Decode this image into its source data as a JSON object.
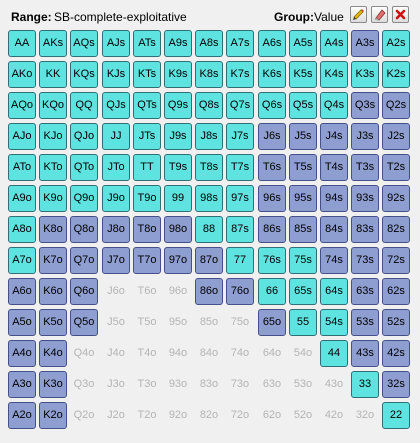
{
  "header": {
    "range_label": "Range:",
    "range_name": "SB-complete-exploitative",
    "group_label": "Group:",
    "group_name": "Value",
    "buttons": [
      "pencil-icon",
      "eraser-icon",
      "close-icon"
    ]
  },
  "colors": {
    "value": "#5fe3e0",
    "other": "#8f9ed0",
    "empty_text": "#b4b4b4"
  },
  "state_legend": {
    "c": "value group",
    "b": "other group",
    "e": "not in range"
  },
  "grid": [
    [
      [
        "AA",
        "c"
      ],
      [
        "AKs",
        "c"
      ],
      [
        "AQs",
        "c"
      ],
      [
        "AJs",
        "c"
      ],
      [
        "ATs",
        "c"
      ],
      [
        "A9s",
        "c"
      ],
      [
        "A8s",
        "c"
      ],
      [
        "A7s",
        "c"
      ],
      [
        "A6s",
        "c"
      ],
      [
        "A5s",
        "c"
      ],
      [
        "A4s",
        "c"
      ],
      [
        "A3s",
        "b"
      ],
      [
        "A2s",
        "c"
      ]
    ],
    [
      [
        "AKo",
        "c"
      ],
      [
        "KK",
        "c"
      ],
      [
        "KQs",
        "c"
      ],
      [
        "KJs",
        "c"
      ],
      [
        "KTs",
        "c"
      ],
      [
        "K9s",
        "c"
      ],
      [
        "K8s",
        "c"
      ],
      [
        "K7s",
        "c"
      ],
      [
        "K6s",
        "c"
      ],
      [
        "K5s",
        "c"
      ],
      [
        "K4s",
        "c"
      ],
      [
        "K3s",
        "c"
      ],
      [
        "K2s",
        "c"
      ]
    ],
    [
      [
        "AQo",
        "c"
      ],
      [
        "KQo",
        "c"
      ],
      [
        "QQ",
        "c"
      ],
      [
        "QJs",
        "c"
      ],
      [
        "QTs",
        "c"
      ],
      [
        "Q9s",
        "c"
      ],
      [
        "Q8s",
        "c"
      ],
      [
        "Q7s",
        "c"
      ],
      [
        "Q6s",
        "c"
      ],
      [
        "Q5s",
        "c"
      ],
      [
        "Q4s",
        "c"
      ],
      [
        "Q3s",
        "b"
      ],
      [
        "Q2s",
        "b"
      ]
    ],
    [
      [
        "AJo",
        "c"
      ],
      [
        "KJo",
        "c"
      ],
      [
        "QJo",
        "c"
      ],
      [
        "JJ",
        "c"
      ],
      [
        "JTs",
        "c"
      ],
      [
        "J9s",
        "c"
      ],
      [
        "J8s",
        "c"
      ],
      [
        "J7s",
        "c"
      ],
      [
        "J6s",
        "b"
      ],
      [
        "J5s",
        "b"
      ],
      [
        "J4s",
        "b"
      ],
      [
        "J3s",
        "b"
      ],
      [
        "J2s",
        "b"
      ]
    ],
    [
      [
        "ATo",
        "c"
      ],
      [
        "KTo",
        "c"
      ],
      [
        "QTo",
        "c"
      ],
      [
        "JTo",
        "c"
      ],
      [
        "TT",
        "c"
      ],
      [
        "T9s",
        "c"
      ],
      [
        "T8s",
        "c"
      ],
      [
        "T7s",
        "c"
      ],
      [
        "T6s",
        "b"
      ],
      [
        "T5s",
        "b"
      ],
      [
        "T4s",
        "b"
      ],
      [
        "T3s",
        "b"
      ],
      [
        "T2s",
        "b"
      ]
    ],
    [
      [
        "A9o",
        "c"
      ],
      [
        "K9o",
        "c"
      ],
      [
        "Q9o",
        "c"
      ],
      [
        "J9o",
        "c"
      ],
      [
        "T9o",
        "c"
      ],
      [
        "99",
        "c"
      ],
      [
        "98s",
        "c"
      ],
      [
        "97s",
        "c"
      ],
      [
        "96s",
        "b"
      ],
      [
        "95s",
        "b"
      ],
      [
        "94s",
        "b"
      ],
      [
        "93s",
        "b"
      ],
      [
        "92s",
        "b"
      ]
    ],
    [
      [
        "A8o",
        "c"
      ],
      [
        "K8o",
        "b"
      ],
      [
        "Q8o",
        "b"
      ],
      [
        "J8o",
        "b"
      ],
      [
        "T8o",
        "b"
      ],
      [
        "98o",
        "b"
      ],
      [
        "88",
        "c"
      ],
      [
        "87s",
        "c"
      ],
      [
        "86s",
        "b"
      ],
      [
        "85s",
        "b"
      ],
      [
        "84s",
        "b"
      ],
      [
        "83s",
        "b"
      ],
      [
        "82s",
        "b"
      ]
    ],
    [
      [
        "A7o",
        "c"
      ],
      [
        "K7o",
        "b"
      ],
      [
        "Q7o",
        "b"
      ],
      [
        "J7o",
        "b"
      ],
      [
        "T7o",
        "b"
      ],
      [
        "97o",
        "b"
      ],
      [
        "87o",
        "b"
      ],
      [
        "77",
        "c"
      ],
      [
        "76s",
        "c"
      ],
      [
        "75s",
        "c"
      ],
      [
        "74s",
        "b"
      ],
      [
        "73s",
        "b"
      ],
      [
        "72s",
        "b"
      ]
    ],
    [
      [
        "A6o",
        "b"
      ],
      [
        "K6o",
        "b"
      ],
      [
        "Q6o",
        "b"
      ],
      [
        "J6o",
        "e"
      ],
      [
        "T6o",
        "e"
      ],
      [
        "96o",
        "e"
      ],
      [
        "86o",
        "b"
      ],
      [
        "76o",
        "b"
      ],
      [
        "66",
        "c"
      ],
      [
        "65s",
        "c"
      ],
      [
        "64s",
        "c"
      ],
      [
        "63s",
        "b"
      ],
      [
        "62s",
        "b"
      ]
    ],
    [
      [
        "A5o",
        "b"
      ],
      [
        "K5o",
        "b"
      ],
      [
        "Q5o",
        "b"
      ],
      [
        "J5o",
        "e"
      ],
      [
        "T5o",
        "e"
      ],
      [
        "95o",
        "e"
      ],
      [
        "85o",
        "e"
      ],
      [
        "75o",
        "e"
      ],
      [
        "65o",
        "b"
      ],
      [
        "55",
        "c"
      ],
      [
        "54s",
        "c"
      ],
      [
        "53s",
        "b"
      ],
      [
        "52s",
        "b"
      ]
    ],
    [
      [
        "A4o",
        "b"
      ],
      [
        "K4o",
        "b"
      ],
      [
        "Q4o",
        "e"
      ],
      [
        "J4o",
        "e"
      ],
      [
        "T4o",
        "e"
      ],
      [
        "94o",
        "e"
      ],
      [
        "84o",
        "e"
      ],
      [
        "74o",
        "e"
      ],
      [
        "64o",
        "e"
      ],
      [
        "54o",
        "e"
      ],
      [
        "44",
        "c"
      ],
      [
        "43s",
        "b"
      ],
      [
        "42s",
        "b"
      ]
    ],
    [
      [
        "A3o",
        "b"
      ],
      [
        "K3o",
        "b"
      ],
      [
        "Q3o",
        "e"
      ],
      [
        "J3o",
        "e"
      ],
      [
        "T3o",
        "e"
      ],
      [
        "93o",
        "e"
      ],
      [
        "83o",
        "e"
      ],
      [
        "73o",
        "e"
      ],
      [
        "63o",
        "e"
      ],
      [
        "53o",
        "e"
      ],
      [
        "43o",
        "e"
      ],
      [
        "33",
        "c"
      ],
      [
        "32s",
        "b"
      ]
    ],
    [
      [
        "A2o",
        "b"
      ],
      [
        "K2o",
        "b"
      ],
      [
        "Q2o",
        "e"
      ],
      [
        "J2o",
        "e"
      ],
      [
        "T2o",
        "e"
      ],
      [
        "92o",
        "e"
      ],
      [
        "82o",
        "e"
      ],
      [
        "72o",
        "e"
      ],
      [
        "62o",
        "e"
      ],
      [
        "52o",
        "e"
      ],
      [
        "42o",
        "e"
      ],
      [
        "32o",
        "e"
      ],
      [
        "22",
        "c"
      ]
    ]
  ]
}
